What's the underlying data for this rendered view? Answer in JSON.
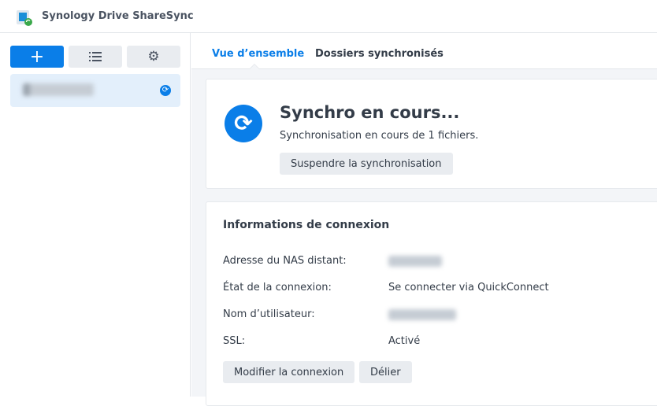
{
  "app": {
    "title": "Synology Drive ShareSync"
  },
  "sidebar": {
    "add_icon": "plus-icon",
    "list_icon": "list-icon",
    "settings_icon": "gear-icon",
    "connection_status_icon": "sync-icon"
  },
  "tabs": [
    {
      "label": "Vue d’ensemble",
      "active": true
    },
    {
      "label": "Dossiers synchronisés",
      "active": false
    }
  ],
  "status": {
    "title": "Synchro en cours...",
    "detail": "Synchronisation en cours de 1 fichiers.",
    "pause_button": "Suspendre la synchronisation"
  },
  "connection": {
    "title": "Informations de connexion",
    "rows": [
      {
        "label": "Adresse du NAS distant:",
        "value": null
      },
      {
        "label": "État de la connexion:",
        "value": "Se connecter via QuickConnect"
      },
      {
        "label": "Nom d’utilisateur:",
        "value": null
      },
      {
        "label": "SSL:",
        "value": "Activé"
      }
    ],
    "edit_button": "Modifier la connexion",
    "delete_button": "Délier"
  },
  "colors": {
    "accent": "#0a7ee8"
  }
}
